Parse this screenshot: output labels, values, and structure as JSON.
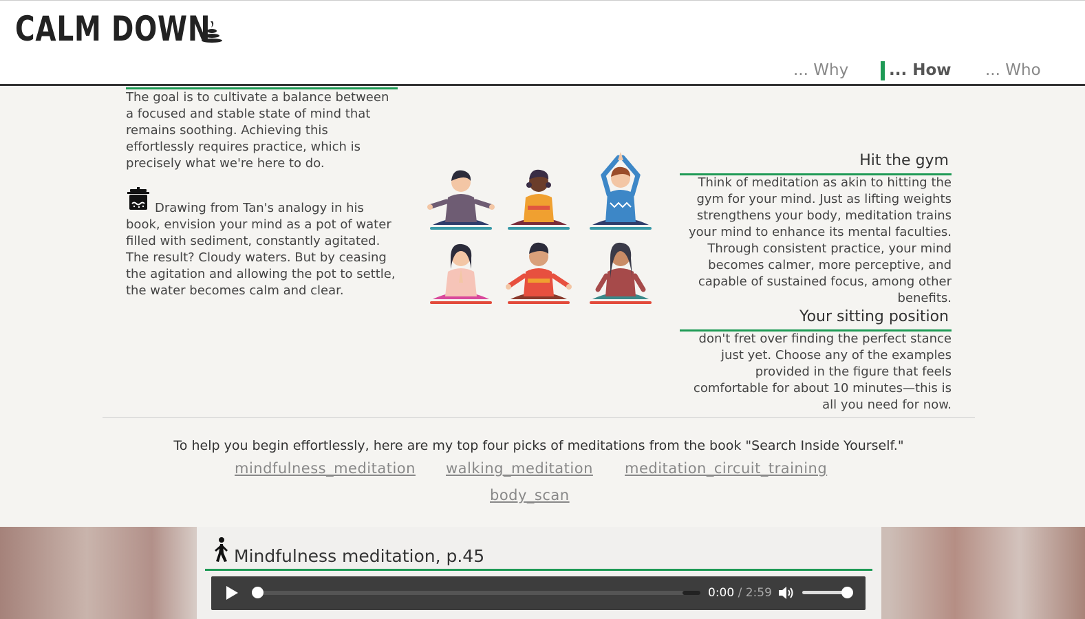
{
  "header": {
    "logo_text": "CALM DOWN",
    "nav": [
      {
        "label": "... Why"
      },
      {
        "label": "... How",
        "active": true
      },
      {
        "label": "... Who"
      }
    ],
    "accent_color": "#1e9a55"
  },
  "left": {
    "p1": "The goal is to cultivate a balance between a focused and stable state of mind that remains soothing. Achieving this effortlessly requires practice, which is precisely what we're here to do.",
    "p2": "Drawing from Tan's analogy in his book, envision your mind as a pot of water filled with sediment, constantly agitated. The result? Cloudy waters. But by ceasing the agitation and allowing the pot to settle, the water becomes calm and clear.",
    "icon": "cooking-pot-icon"
  },
  "right": {
    "gym_title": "Hit the gym",
    "gym_text": "Think of meditation as akin to hitting the gym for your mind. Just as lifting weights strengthens your body, meditation trains your mind to enhance its mental faculties. Through consistent practice, your mind becomes calmer, more perceptive, and capable of sustained focus, among other benefits.",
    "sit_title": "Your sitting position",
    "sit_text": "don't fret over finding the perfect stance just yet. Choose any of the examples provided in the figure that feels comfortable for about 10 minutes—this is all you need for now."
  },
  "meditations": {
    "intro": "To help you begin effortlessly, here are my top four picks of meditations from the book \"Search Inside Yourself.\"",
    "links": [
      "mindfulness_meditation",
      "walking_meditation",
      "meditation_circuit_training",
      "body_scan"
    ]
  },
  "player": {
    "title": "Mindfulness meditation, p.45",
    "current_time": "0:00",
    "separator": "/",
    "duration": "2:59",
    "progress": 0,
    "volume": 1.0,
    "icon": "walking-person-icon"
  }
}
